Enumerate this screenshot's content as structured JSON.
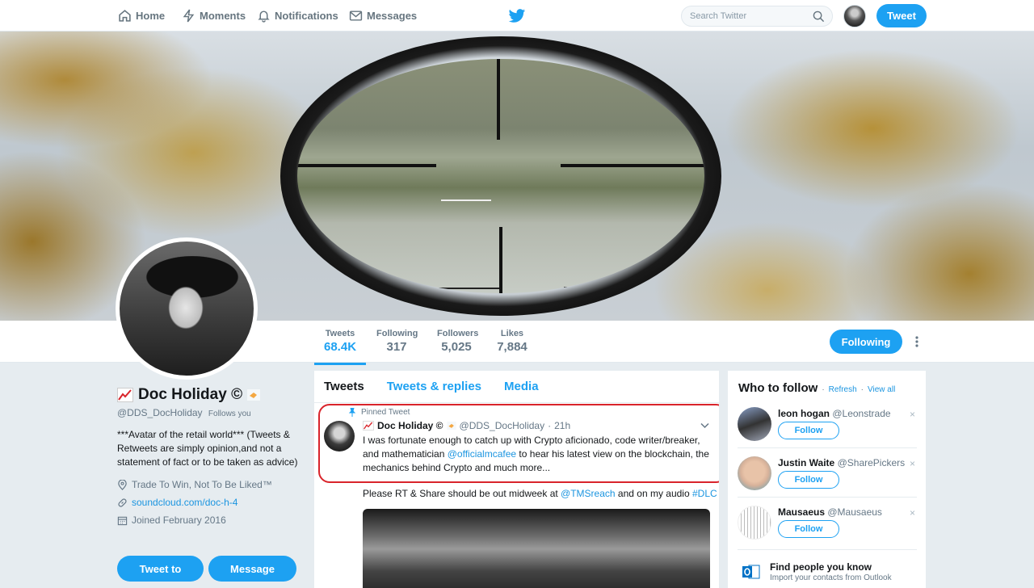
{
  "nav": {
    "home": "Home",
    "moments": "Moments",
    "notifications": "Notifications",
    "messages": "Messages",
    "search_placeholder": "Search Twitter",
    "tweet_button": "Tweet"
  },
  "stats": [
    {
      "label": "Tweets",
      "value": "68.4K"
    },
    {
      "label": "Following",
      "value": "317"
    },
    {
      "label": "Followers",
      "value": "5,025"
    },
    {
      "label": "Likes",
      "value": "7,884"
    }
  ],
  "following_button": "Following",
  "profile": {
    "name": "Doc Holiday ©",
    "handle": "@DDS_DocHoliday",
    "follows_you": "Follows you",
    "bio": "***Avatar of the retail world*** (Tweets & Retweets are simply opinion,and not a statement of fact or to be taken as advice)",
    "location": "Trade To Win, Not To Be Liked™",
    "website": "soundcloud.com/doc-h-4",
    "joined": "Joined February 2016",
    "tweet_to": "Tweet to",
    "message": "Message"
  },
  "timeline": {
    "tabs": [
      "Tweets",
      "Tweets & replies",
      "Media"
    ],
    "pinned_label": "Pinned Tweet",
    "tweet": {
      "name": "Doc Holiday ©",
      "handle": "@DDS_DocHoliday",
      "separator": "·",
      "time": "21h",
      "text_1": "I was fortunate enough to catch up with Crypto aficionado, code writer/breaker, and mathematician",
      "mention": "@officialmcafee",
      "text_2": "to hear his latest view on the blockchain, the mechanics behind Crypto and much more...",
      "line2_text": "Please RT & Share should be out midweek at",
      "line2_mention": "@TMSreach",
      "line2_mid": "and on my audio",
      "line2_hashtag": "#DLC"
    }
  },
  "who_to_follow": {
    "title": "Who to follow",
    "refresh": "Refresh",
    "dot": "·",
    "view_all": "View all",
    "follow_label": "Follow",
    "dismiss": "×",
    "suggestions": [
      {
        "name": "leon hogan",
        "handle": "@Leonstrade"
      },
      {
        "name": "Justin Waite",
        "handle": "@SharePickers"
      },
      {
        "name": "Mausaeus",
        "handle": "@Mausaeus"
      }
    ],
    "find_title": "Find people you know",
    "find_sub": "Import your contacts from Outlook"
  },
  "colors": {
    "accent": "#1da1f2",
    "pinned_outline": "#d9242b"
  }
}
